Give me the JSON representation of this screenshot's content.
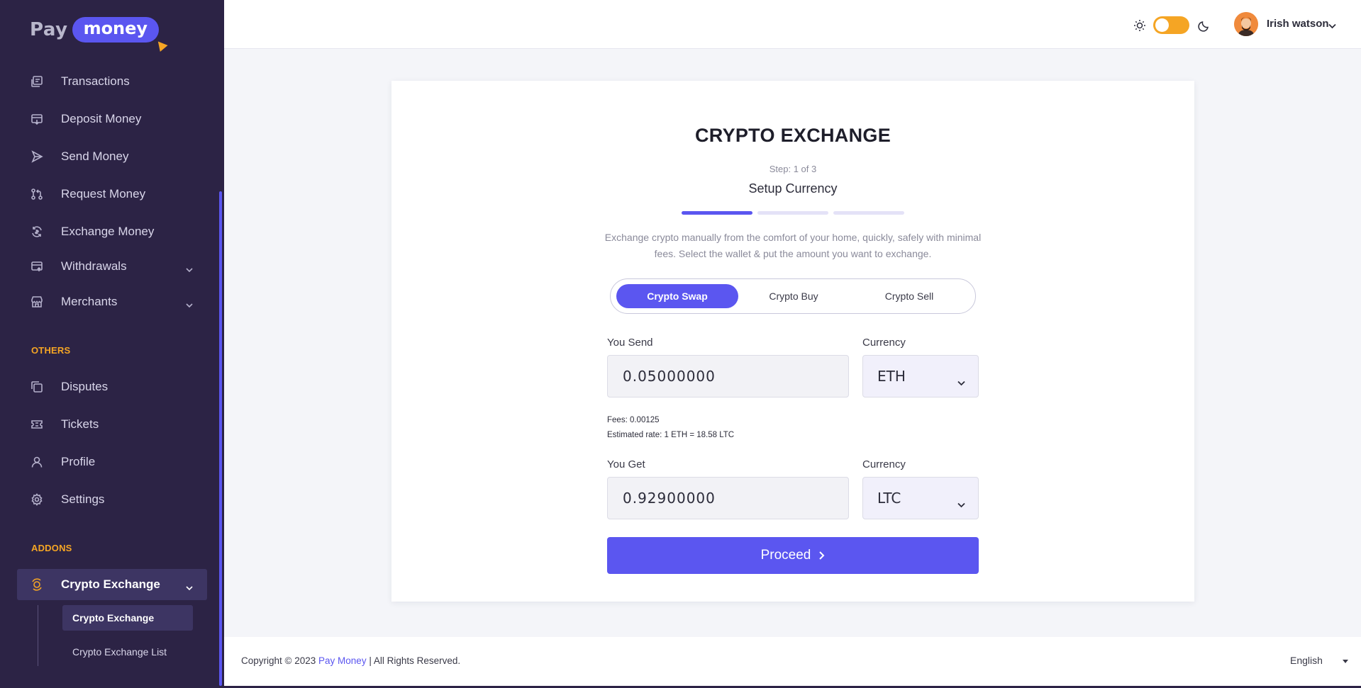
{
  "brand": {
    "logo_pay": "Pay",
    "logo_money": "money"
  },
  "sidebar": {
    "items": [
      {
        "label": "Transactions",
        "icon": "transactions-icon"
      },
      {
        "label": "Deposit Money",
        "icon": "deposit-icon"
      },
      {
        "label": "Send Money",
        "icon": "send-icon"
      },
      {
        "label": "Request Money",
        "icon": "request-icon"
      },
      {
        "label": "Exchange Money",
        "icon": "exchange-icon"
      },
      {
        "label": "Withdrawals",
        "icon": "withdrawals-icon",
        "has_submenu": true
      },
      {
        "label": "Merchants",
        "icon": "merchants-icon",
        "has_submenu": true
      }
    ],
    "others_label": "OTHERS",
    "others_items": [
      {
        "label": "Disputes",
        "icon": "disputes-icon"
      },
      {
        "label": "Tickets",
        "icon": "tickets-icon"
      },
      {
        "label": "Profile",
        "icon": "profile-icon"
      },
      {
        "label": "Settings",
        "icon": "settings-icon"
      }
    ],
    "addons_label": "ADDONS",
    "addons_item": {
      "label": "Crypto Exchange",
      "icon": "crypto-exchange-icon",
      "expanded": true
    },
    "addons_subitems": [
      {
        "label": "Crypto Exchange",
        "active": true
      },
      {
        "label": "Crypto Exchange List",
        "active": false
      }
    ]
  },
  "header": {
    "theme_toggle": "light",
    "user_name": "Irish watson"
  },
  "card": {
    "title": "CRYPTO EXCHANGE",
    "step_text": "Step: 1 of 3",
    "step_title": "Setup Currency",
    "progress_steps_done": 1,
    "progress_steps_total": 3,
    "description": "Exchange crypto manually from the comfort of your home, quickly, safely with minimal fees. Select the wallet & put the amount you want to exchange.",
    "tabs": [
      {
        "label": "Crypto Swap",
        "active": true
      },
      {
        "label": "Crypto Buy",
        "active": false
      },
      {
        "label": "Crypto Sell",
        "active": false
      }
    ],
    "send": {
      "label": "You Send",
      "value": "0.05000000",
      "currency_label": "Currency",
      "currency": "ETH"
    },
    "fees_text": "Fees: 0.00125",
    "rate_text": "Estimated rate: 1 ETH = 18.58 LTC",
    "get": {
      "label": "You Get",
      "value": "0.92900000",
      "currency_label": "Currency",
      "currency": "LTC"
    },
    "proceed_label": "Proceed"
  },
  "footer": {
    "copyright_prefix": "Copyright © 2023",
    "copyright_brand": "Pay Money",
    "copyright_suffix": "| All Rights Reserved.",
    "language": "English"
  },
  "colors": {
    "sidebar_bg": "#2c2345",
    "accent": "#5b56f0",
    "section_label": "#f5a524",
    "toggle": "#f5a524"
  }
}
